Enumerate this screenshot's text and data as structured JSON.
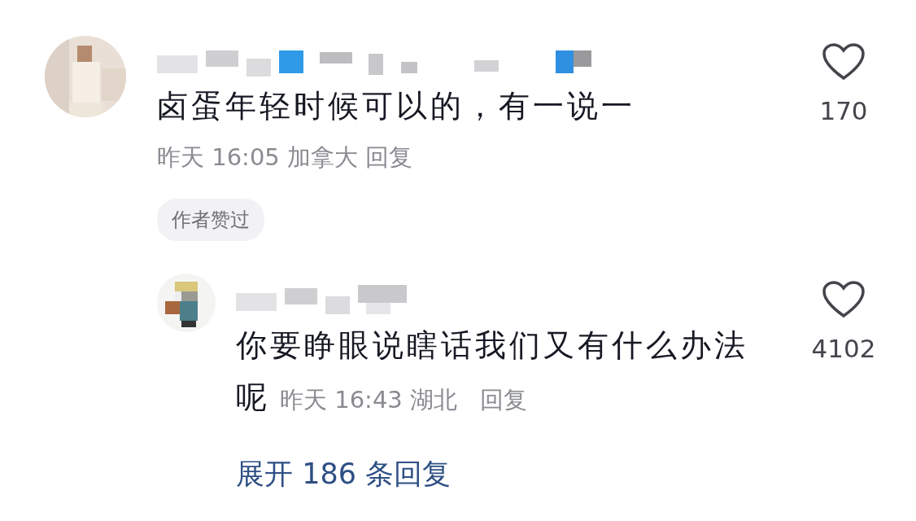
{
  "comment": {
    "text": "卤蛋年轻时候可以的，有一说一",
    "date": "昨天",
    "time": "16:05",
    "location": "加拿大",
    "reply": "回复",
    "likes": "170",
    "liked": false,
    "badge": "作者赞过",
    "replies": [
      {
        "text": "你要睁眼说瞎话我们又有什么办法呢",
        "date": "昨天",
        "time": "16:43",
        "location": "湖北",
        "reply": "回复",
        "likes": "4102",
        "liked": false
      }
    ]
  },
  "expand": "展开 186 条回复"
}
